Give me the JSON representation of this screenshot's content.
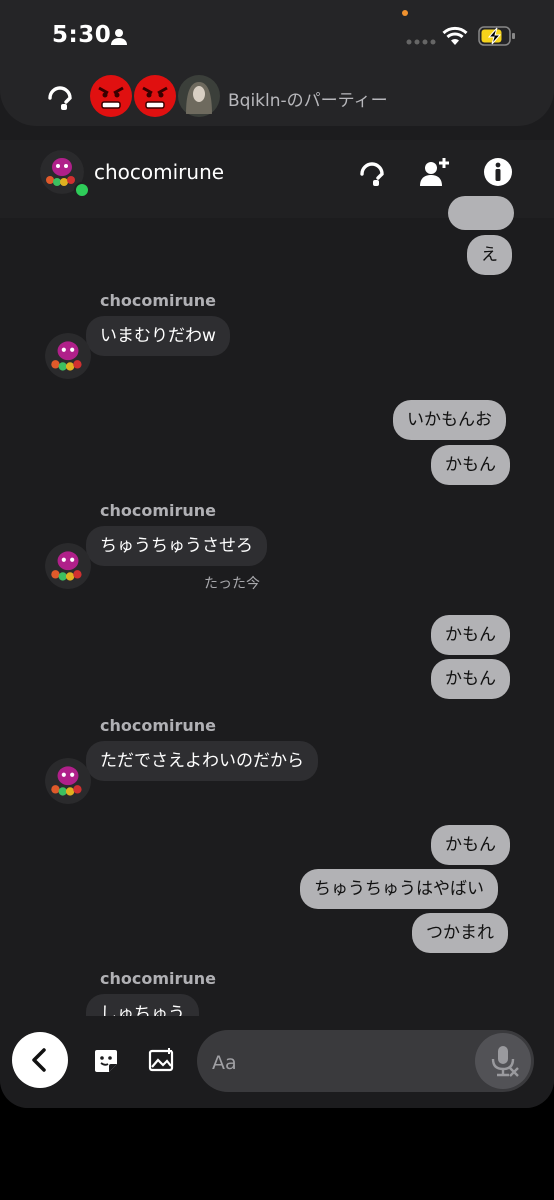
{
  "status_bar": {
    "time": "5:30"
  },
  "party": {
    "title": "Bqikln-のパーティー"
  },
  "chat": {
    "name": "chocomirune"
  },
  "messages": {
    "out_top_partial": "…",
    "out_e": "え",
    "sender1": "chocomirune",
    "in1": "いまむりだわw",
    "out1": "いかもんお",
    "out2": "かもん",
    "sender2": "chocomirune",
    "in2": "ちゅうちゅうさせろ",
    "timestamp": "たった今",
    "out3": "かもん",
    "out4": "かもん",
    "sender3": "chocomirune",
    "in3": "ただでさえよわいのだから",
    "out5": "かもん",
    "out6": "ちゅうちゅうはやばい",
    "out7": "つかまれ",
    "sender4": "chocomirune",
    "in4": "しゅちゅう"
  },
  "composer": {
    "placeholder": "Aa"
  },
  "colors": {
    "online": "#2ecc59",
    "notification_dot": "#f0922f",
    "battery_charge": "#f5d31b"
  },
  "icons": [
    "person-icon",
    "signal-icon",
    "wifi-icon",
    "battery-icon",
    "headset-icon",
    "add-friend-icon",
    "info-icon",
    "back-icon",
    "sticker-icon",
    "image-icon",
    "mic-off-icon"
  ]
}
